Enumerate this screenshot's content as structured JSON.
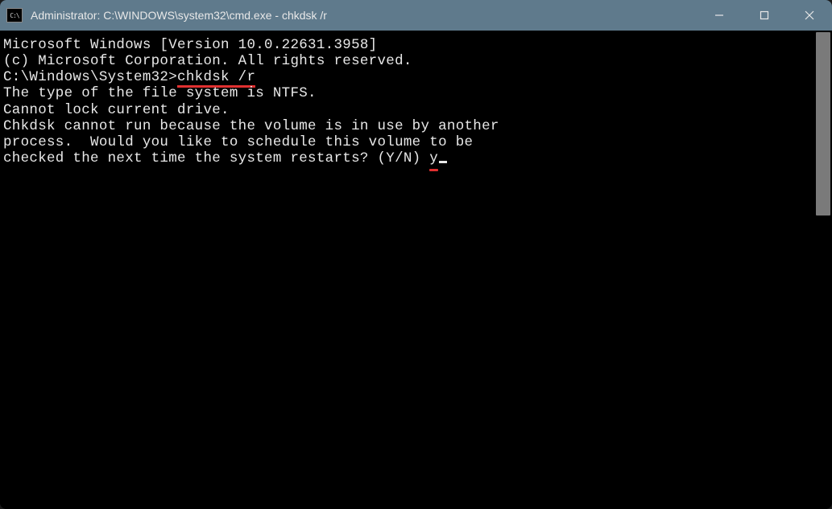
{
  "titlebar": {
    "icon_text": "C:\\",
    "title": "Administrator: C:\\WINDOWS\\system32\\cmd.exe - chkdsk  /r"
  },
  "terminal": {
    "line1": "Microsoft Windows [Version 10.0.22631.3958]",
    "line2": "(c) Microsoft Corporation. All rights reserved.",
    "blank1": "",
    "prompt_prefix": "C:\\Windows\\System32>",
    "prompt_command": "chkdsk /r",
    "line4": "The type of the file system is NTFS.",
    "line5": "Cannot lock current drive.",
    "blank2": "",
    "line6": "Chkdsk cannot run because the volume is in use by another",
    "line7": "process.  Would you like to schedule this volume to be",
    "line8_prefix": "checked the next time the system restarts? (Y/N) ",
    "line8_input": "y"
  }
}
